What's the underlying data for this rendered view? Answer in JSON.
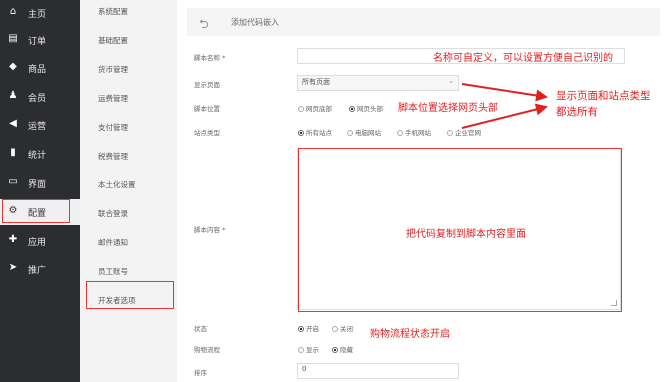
{
  "sidebar": {
    "items": [
      {
        "label": "主页",
        "icon": "home-icon",
        "glyph": "⌂"
      },
      {
        "label": "订单",
        "icon": "order-icon",
        "glyph": "▤"
      },
      {
        "label": "商品",
        "icon": "cube-icon",
        "glyph": "◆"
      },
      {
        "label": "会员",
        "icon": "user-icon",
        "glyph": "♟"
      },
      {
        "label": "运营",
        "icon": "megaphone-icon",
        "glyph": "◀"
      },
      {
        "label": "统计",
        "icon": "chart-icon",
        "glyph": "▮"
      },
      {
        "label": "界面",
        "icon": "window-icon",
        "glyph": "▭"
      },
      {
        "label": "配置",
        "icon": "gear-icon",
        "glyph": "⚙"
      },
      {
        "label": "应用",
        "icon": "puzzle-icon",
        "glyph": "✚"
      },
      {
        "label": "推广",
        "icon": "send-icon",
        "glyph": "➤"
      }
    ]
  },
  "subnav": {
    "items": [
      "系统配置",
      "基础配置",
      "货币管理",
      "运费管理",
      "支付管理",
      "税费管理",
      "本土化设置",
      "联合登录",
      "邮件通知",
      "员工账号",
      "开发者选项"
    ]
  },
  "header": {
    "back_icon": "undo-icon",
    "title": "添加代码嵌入"
  },
  "form": {
    "name_label": "脚本名称 *",
    "name_value": "",
    "page_label": "显示页面",
    "page_value": "所有页面",
    "position_label": "脚本位置",
    "position_options": [
      "网页底部",
      "网页头部"
    ],
    "site_label": "站点类型",
    "site_options": [
      "所有站点",
      "电脑网站",
      "手机网站",
      "企业官网"
    ],
    "content_label": "脚本内容 *",
    "status_label": "状态",
    "status_options": [
      "开启",
      "关闭"
    ],
    "shopping_label": "购物流程",
    "shopping_options": [
      "显示",
      "隐藏"
    ],
    "order_label": "排序",
    "order_value": "0"
  },
  "annotations": {
    "name_note": "名称可自定义，可以设置方便自己识别的",
    "page_note_1": "显示页面和站点类型",
    "page_note_2": "都选所有",
    "position_note": "脚本位置选择网页头部",
    "content_note": "把代码复制到脚本内容里面",
    "status_note": "购物流程状态开启"
  },
  "colors": {
    "sidebar_bg": "#2b2d31",
    "annotation_red": "#e02020"
  }
}
